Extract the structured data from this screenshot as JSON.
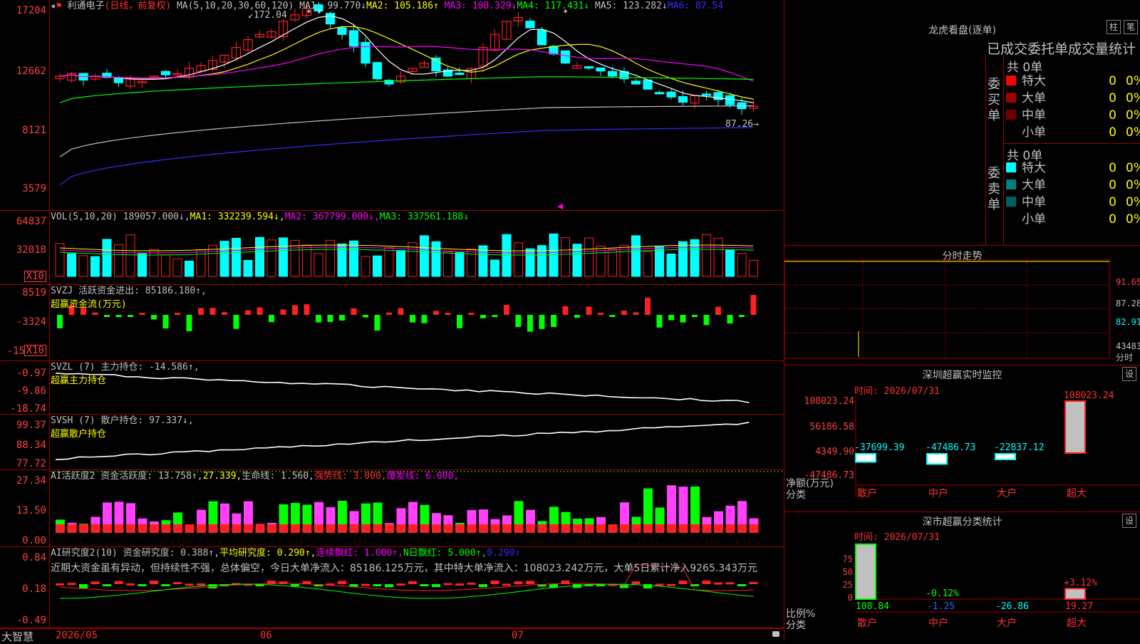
{
  "colors": {
    "up": "#ff2020",
    "down": "#00ffff",
    "ma1": "#ffffff",
    "ma2": "#ffff00",
    "ma3": "#ff00ff",
    "ma4": "#00ff00",
    "ma5": "#c0c0c0",
    "ma6": "#3030ff"
  },
  "price": {
    "stock_name": "利通电子",
    "mode": "(日线，前复权)",
    "ma_params": "MA(5,10,20,30,60,120)",
    "ma1": "MA1: 99.770↓",
    "ma2": "MA2: 105.186↑",
    "ma3": "MA3: 108.329↓",
    "ma4": "MA4: 117.431↓",
    "ma5": "MA5: 123.282↓",
    "ma6": "MA6: 87.54",
    "ticks": [
      "17204",
      "12662",
      "8121",
      "3579"
    ],
    "high_label": "172.04",
    "low_label": "87.26"
  },
  "volume": {
    "hdr": "VOL(5,10,20) 189057.000↓,",
    "ma1": "MA1: 332239.594↓,",
    "ma2": "MA2: 367799.000↓,",
    "ma3": "MA3: 337561.188↓",
    "ticks": [
      "64837",
      "32018"
    ],
    "unit": "X10"
  },
  "svzj": {
    "hdr": "SVZJ  活跃资金进出: 85186.180↑,",
    "sub": "超赢资金流(万元)",
    "ticks": [
      "8519",
      "-3324",
      "-15"
    ],
    "unit": "X10"
  },
  "svzl": {
    "hdr": "SVZL (7) 主力持仓: -14.586↑,",
    "sub": "超赢主力持仓",
    "ticks": [
      "-0.97",
      "-9.86",
      "-18.74"
    ]
  },
  "svsh": {
    "hdr": "SVSH (7) 散户持仓: 97.337↓,",
    "sub": "超赢散户持仓",
    "ticks": [
      "99.37",
      "88.34",
      "77.72"
    ]
  },
  "ai1": {
    "hdr_a": "AI活跃度2 资金活跃度: 13.758↑,",
    "hdr_b": "27.339,",
    "hdr_c": "生命线: 1.560,",
    "hdr_d": "强势线: 3.000,",
    "hdr_e": "爆发线: 6.000,",
    "ticks": [
      "27.34",
      "13.50",
      "0.00"
    ]
  },
  "ai2": {
    "hdr_a": "AI研究度2(10) 资金研究度: 0.388↑,",
    "hdr_b": "平均研究度: 0.290↑,",
    "hdr_c": "连续飘红: 1.000↑,",
    "hdr_d": "N日飘红: 5.000↑,",
    "hdr_e": "0.290↑",
    "comment": "近期大资金虽有异动，但持续性不强，总体偏空，今日大单净流入：85186.125万元，其中特大单净流入：108023.242万元，大单5日累计净入9265.343万元",
    "ticks": [
      "0.84",
      "0.18",
      "-0.49"
    ]
  },
  "dates": [
    "2026/05",
    "06",
    "07"
  ],
  "brand": "大智慧",
  "longhu": {
    "title": "龙虎看盘(逐单)",
    "btn_a": "柱",
    "btn_b": "笔",
    "subtitle": "已成交委托单成交量统计",
    "buy_label": "委买单",
    "sell_label": "委卖单",
    "buy_total": "共 0单",
    "sell_total": "共 0单",
    "buy_rows": [
      {
        "label": "特大",
        "val": "0",
        "pct": "0%",
        "color": "#ff0000"
      },
      {
        "label": "大单",
        "val": "0",
        "pct": "0%",
        "color": "#a00000"
      },
      {
        "label": "中单",
        "val": "0",
        "pct": "0%",
        "color": "#700000"
      },
      {
        "label": "小单",
        "val": "0",
        "pct": "0%",
        "color": "#000000"
      }
    ],
    "sell_rows": [
      {
        "label": "特大",
        "val": "0",
        "pct": "0%",
        "color": "#00ffff"
      },
      {
        "label": "大单",
        "val": "0",
        "pct": "0%",
        "color": "#008080"
      },
      {
        "label": "中单",
        "val": "0",
        "pct": "0%",
        "color": "#006060"
      },
      {
        "label": "小单",
        "val": "0",
        "pct": "0%",
        "color": "#000000"
      }
    ]
  },
  "fenshi": {
    "title": "分时走势",
    "ticks": [
      "91.65",
      "87.28",
      "82.91",
      "43483"
    ],
    "unit": "分时"
  },
  "monitor": {
    "title": "深圳超赢实时监控",
    "btn": "设",
    "time": "时间: 2026/07/31",
    "ticks": [
      "108023.24",
      "56186.58",
      "4349.90",
      "-47486.73"
    ],
    "net_label": "净额(万元)",
    "cls_label": "分类",
    "categories": [
      "散户",
      "中户",
      "大户",
      "超大"
    ],
    "values": [
      -37699.39,
      -47486.73,
      -22837.12,
      108023.24
    ],
    "value_labels": [
      "-37699.39",
      "-47486.73",
      "-22837.12",
      "108023.24"
    ]
  },
  "stats": {
    "title": "深市超赢分类统计",
    "btn": "设",
    "time": "时间: 2026/07/31",
    "ticks": [
      "75",
      "50",
      "25",
      "0"
    ],
    "ratio_label": "比例%",
    "cls_label": "分类",
    "categories": [
      "散户",
      "中户",
      "大户",
      "超大"
    ],
    "ratios": [
      108.84,
      -1.25,
      -26.86,
      19.27
    ],
    "ratio_labels": [
      "108.84",
      "-1.25",
      "-26.86",
      "19.27"
    ],
    "chg_labels": [
      "",
      "-0.12%",
      "",
      "+3.12%"
    ]
  }
}
